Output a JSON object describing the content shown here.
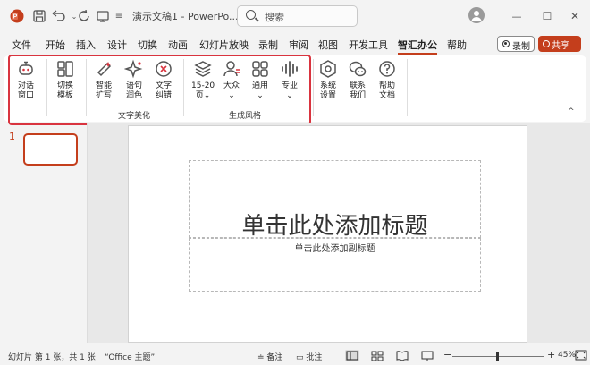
{
  "title_bar": {
    "doc_title": "演示文稿1 - PowerPo...",
    "search_placeholder": "搜索",
    "minimize": "—",
    "maximize": "☐",
    "close": "✕"
  },
  "menu_tabs": [
    "文件",
    "开始",
    "插入",
    "设计",
    "切换",
    "动画",
    "幻灯片放映",
    "录制",
    "审阅",
    "视图",
    "开发工具",
    "智汇办公",
    "帮助"
  ],
  "active_tab": "智汇办公",
  "header_buttons": {
    "record": "录制",
    "share": "共享"
  },
  "ribbon": {
    "buttons": {
      "dialog": "对话\n窗口",
      "switch_template": "切换\n模板",
      "smart_expand": "智能\n扩写",
      "polish": "语句\n润色",
      "correct": "文字\n纠错",
      "pages": "15-20\n页⌄",
      "public": "大众\n⌄",
      "general": "通用\n⌄",
      "professional": "专业\n⌄",
      "settings": "系统\n设置",
      "contact": "联系\n我们",
      "help": "帮助\n文档"
    },
    "groups": {
      "text_beautify": "文字美化",
      "generate_style": "生成风格"
    },
    "collapse": "^"
  },
  "thumbnails": {
    "number": "1"
  },
  "slide": {
    "title_placeholder": "单击此处添加标题",
    "subtitle_placeholder": "单击此处添加副标题"
  },
  "status_bar": {
    "slide_info": "幻灯片 第 1 张，共 1 张",
    "theme": "“Office 主题”",
    "notes": "备注",
    "comments": "批注",
    "zoom_minus": "−",
    "zoom_plus": "+",
    "zoom": "45%"
  },
  "colors": {
    "accent": "#c43e1c",
    "highlight_box": "#d9343f",
    "icon": "#555555"
  }
}
